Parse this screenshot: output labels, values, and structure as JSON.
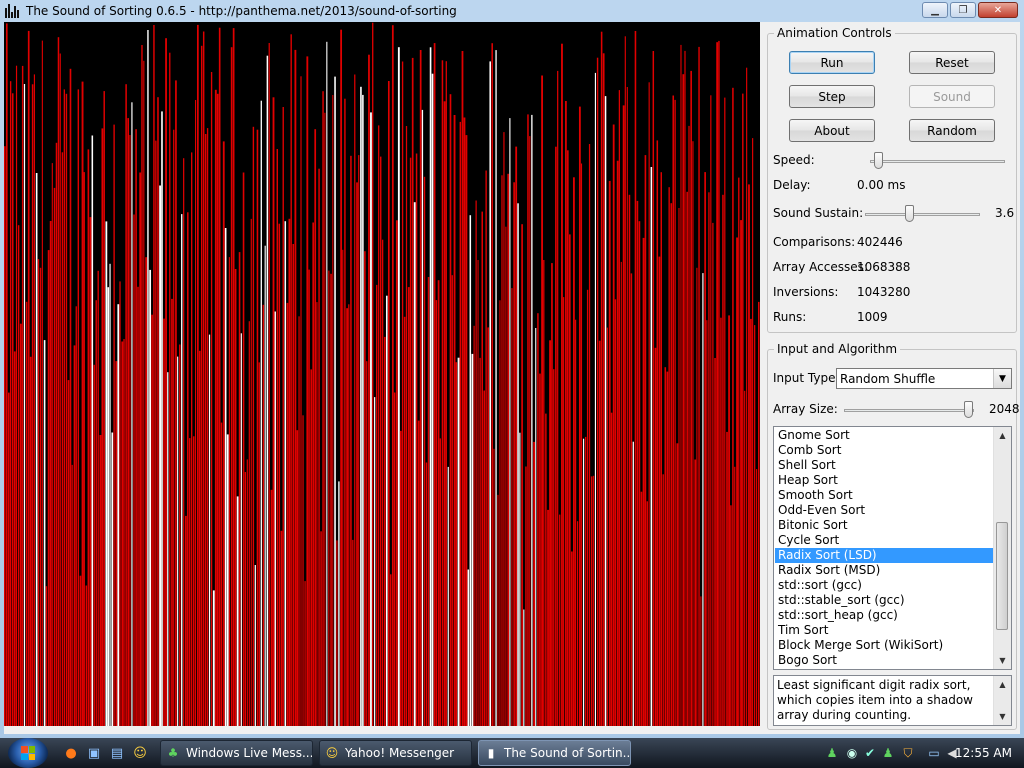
{
  "window": {
    "title": "The Sound of Sorting 0.6.5 - http://panthema.net/2013/sound-of-sorting",
    "min_symbol": "▁",
    "max_symbol": "❐",
    "close_symbol": "✕"
  },
  "animation_controls": {
    "legend": "Animation Controls",
    "run": "Run",
    "reset": "Reset",
    "step": "Step",
    "sound": "Sound",
    "about": "About",
    "random": "Random",
    "speed_label": "Speed:",
    "speed_level": 0.02,
    "delay_label": "Delay:",
    "delay_value": "0.00 ms",
    "sustain_label": "Sound Sustain:",
    "sustain_value": "3.6",
    "sustain_level": 0.37,
    "comparisons_label": "Comparisons:",
    "comparisons_value": "402446",
    "accesses_label": "Array Accesses:",
    "accesses_value": "1068388",
    "inversions_label": "Inversions:",
    "inversions_value": "1043280",
    "runs_label": "Runs:",
    "runs_value": "1009"
  },
  "input_algorithm": {
    "legend": "Input and Algorithm",
    "input_type_label": "Input Type:",
    "input_type_value": "Random Shuffle",
    "array_size_label": "Array Size:",
    "array_size_value": "2048",
    "array_size_level": 1.0,
    "algorithms": [
      "Gnome Sort",
      "Comb Sort",
      "Shell Sort",
      "Heap Sort",
      "Smooth Sort",
      "Odd-Even Sort",
      "Bitonic Sort",
      "Cycle Sort",
      "Radix Sort (LSD)",
      "Radix Sort (MSD)",
      "std::sort (gcc)",
      "std::stable_sort (gcc)",
      "std::sort_heap (gcc)",
      "Tim Sort",
      "Block Merge Sort (WikiSort)",
      "Bogo Sort"
    ],
    "selected_algorithm": "Radix Sort (LSD)",
    "description": "Least significant digit radix sort, which copies item into a shadow array during counting."
  },
  "taskbar": {
    "tasks": [
      {
        "label": "Windows Live Mess...",
        "icon": "messenger-icon"
      },
      {
        "label": "Yahoo! Messenger",
        "icon": "yahoo-icon"
      },
      {
        "label": "The Sound of Sortin...",
        "icon": "sorting-app-icon"
      }
    ],
    "clock": "12:55 AM"
  },
  "colors": {
    "bar_red": "#e00000",
    "bar_white": "#ffffff",
    "selection": "#3399ff"
  }
}
